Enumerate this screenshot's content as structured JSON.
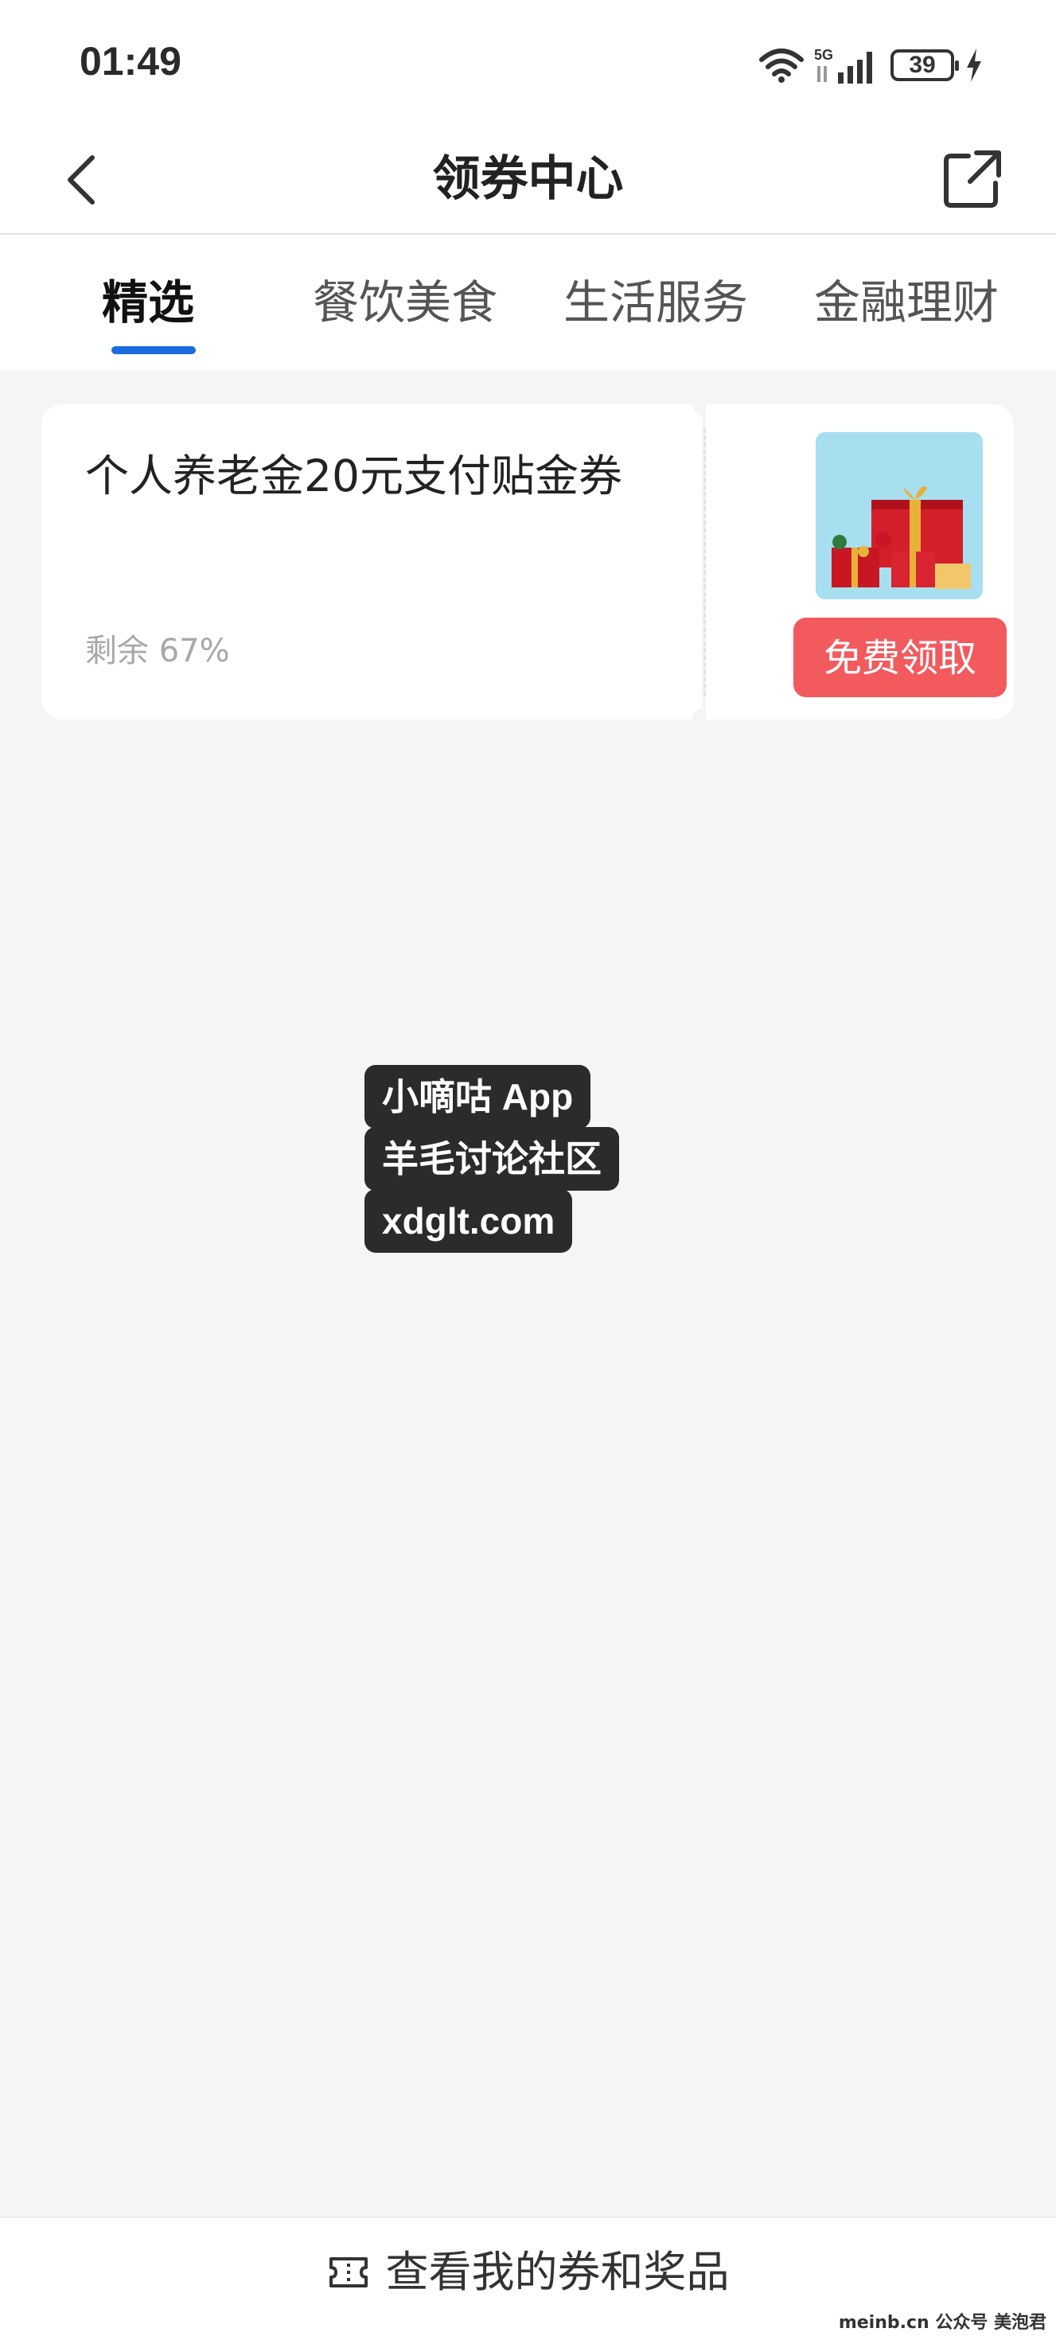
{
  "status": {
    "time": "01:49",
    "battery": "39",
    "network": "5G"
  },
  "header": {
    "title": "领券中心"
  },
  "tabs": [
    {
      "label": "精选",
      "active": true
    },
    {
      "label": "餐饮美食",
      "active": false
    },
    {
      "label": "生活服务",
      "active": false
    },
    {
      "label": "金融理财",
      "active": false
    }
  ],
  "coupons": [
    {
      "title": "个人养老金20元支付贴金券",
      "remaining": "剩余 67%",
      "button": "免费领取"
    }
  ],
  "watermark": {
    "line1": "小嘀咕 App",
    "line2": "羊毛讨论社区",
    "line3": "xdglt.com"
  },
  "footer": {
    "link_label": "查看我的券和奖品"
  },
  "credit": "meinb.cn 公众号 美泡君",
  "colors": {
    "accent": "#1a6be0",
    "button": "#f25a5e",
    "background": "#f5f5f5"
  }
}
